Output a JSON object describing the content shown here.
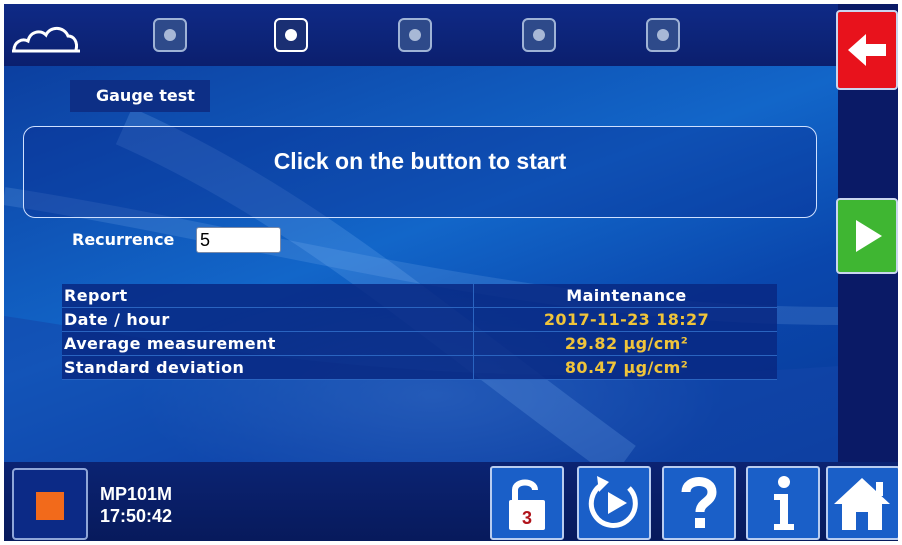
{
  "header": {
    "steps": [
      {
        "name": "step-1",
        "active": false
      },
      {
        "name": "step-2",
        "active": true
      },
      {
        "name": "step-3",
        "active": false
      },
      {
        "name": "step-4",
        "active": false
      },
      {
        "name": "step-5",
        "active": false
      }
    ],
    "back_icon": "arrow-left-icon"
  },
  "main": {
    "tab_label": "Gauge test",
    "message": "Click on the button to start",
    "recurrence": {
      "label": "Recurrence",
      "value": "5"
    },
    "report": {
      "header": {
        "label": "Report",
        "value": "Maintenance"
      },
      "rows": [
        {
          "label": "Date / hour",
          "value": "2017-11-23 18:27"
        },
        {
          "label": "Average measurement",
          "value": "29.82 µg/cm²"
        },
        {
          "label": "Standard deviation",
          "value": "80.47 µg/cm²"
        }
      ]
    },
    "start_icon": "play-icon"
  },
  "footer": {
    "device_name": "MP101M",
    "time": "17:50:42",
    "lock_level": "3",
    "tools": [
      "lock-icon",
      "replay-icon",
      "help-icon",
      "info-icon",
      "home-icon"
    ]
  },
  "colors": {
    "accent_value": "#f0c43a",
    "back_button": "#e8121c",
    "play_button": "#3fb632",
    "stop_square": "#f26a1b"
  }
}
